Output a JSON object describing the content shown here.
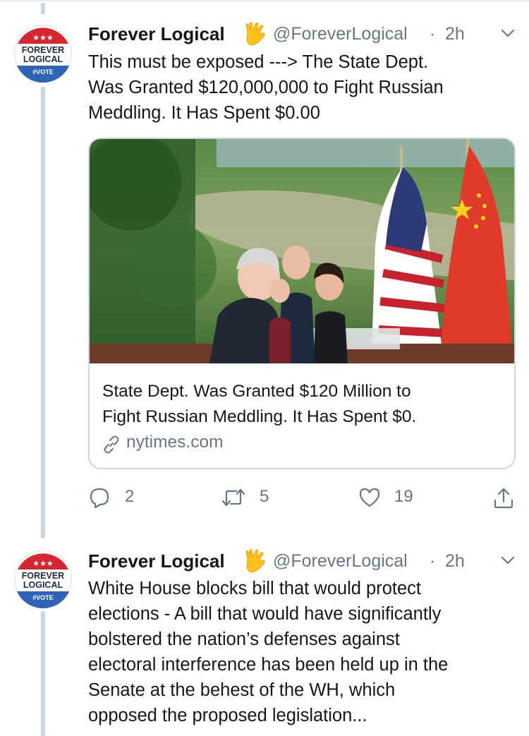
{
  "tweets": [
    {
      "author": {
        "display_name": "Forever Logical",
        "badge_emoji": "vulcan-salute-emoji",
        "handle": "@ForeverLogical",
        "separator": "·",
        "time": "2h",
        "avatar": {
          "top_text": "FOREVER",
          "bottom_text": "LOGICAL",
          "banner_text": "#VOTE",
          "stars": "★★★"
        }
      },
      "text_lines": [
        "This must be exposed ---> The State Dept.",
        "Was Granted $120,000,000 to Fight Russian",
        "Meddling. It Has Spent $0.00"
      ],
      "card": {
        "title_lines": [
          "State Dept. Was Granted $120 Million to",
          "Fight Russian Meddling. It Has Spent $0."
        ],
        "domain": "nytimes.com"
      },
      "actions": {
        "replies": "2",
        "retweets": "5",
        "likes": "19"
      }
    },
    {
      "author": {
        "display_name": "Forever Logical",
        "badge_emoji": "vulcan-salute-emoji",
        "handle": "@ForeverLogical",
        "separator": "·",
        "time": "2h",
        "avatar": {
          "top_text": "FOREVER",
          "bottom_text": "LOGICAL",
          "banner_text": "#VOTE",
          "stars": "★★★"
        }
      },
      "text_lines": [
        "White House blocks bill that would protect",
        "elections - A bill that would have significantly",
        "bolstered the nation’s defenses against",
        "electoral interference has been held up in the",
        "Senate at the behest of the WH, which",
        "opposed the proposed legislation..."
      ]
    }
  ],
  "colors": {
    "text_primary": "#14171a",
    "text_secondary": "#657786",
    "thread_line": "#cdd6dd",
    "border": "#ccd6dd",
    "avatar_red": "#d7262f",
    "avatar_blue": "#2e63b5"
  }
}
